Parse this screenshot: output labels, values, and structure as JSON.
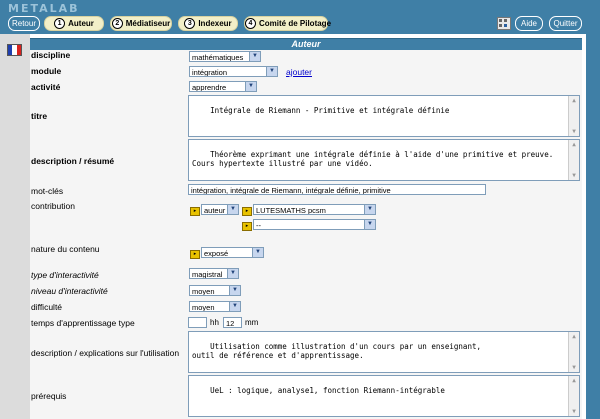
{
  "app": {
    "logo": "METALAB"
  },
  "nav": {
    "retour": "Retour",
    "steps": [
      {
        "num": "1",
        "label": "Auteur"
      },
      {
        "num": "2",
        "label": "Médiatiseur"
      },
      {
        "num": "3",
        "label": "Indexeur"
      },
      {
        "num": "4",
        "label": "Comité de Pilotage"
      }
    ],
    "aide": "Aide",
    "quitter": "Quitter"
  },
  "section_title": "Auteur",
  "colors": {
    "bar": "#3f7fa6",
    "step_bg": "#f2efc8",
    "link": "#0000cc"
  },
  "icons": {
    "flag": "french-flag-icon",
    "tool": "toolbar-grid-icon",
    "info": "info-marker-icon"
  },
  "form": {
    "discipline": {
      "label": "discipline",
      "value": "mathématiques"
    },
    "module": {
      "label": "module",
      "value": "intégration",
      "add_link": "ajouter"
    },
    "activite": {
      "label": "activité",
      "value": "apprendre"
    },
    "titre": {
      "label": "titre",
      "value": "Intégrale de Riemann - Primitive et intégrale définie"
    },
    "description": {
      "label": "description / résumé",
      "value": "Théorème exprimant une intégrale définie à l'aide d'une primitive et preuve.\nCours hypertexte illustré par une vidéo."
    },
    "motcles": {
      "label": "mot-clés",
      "value": "intégration, intégrale de Riemann, intégrale définie, primitive"
    },
    "contribution": {
      "label": "contribution",
      "role": "auteur",
      "org": "LUTESMATHS pcsm",
      "org2": "--"
    },
    "nature": {
      "label": "nature du contenu",
      "value": "exposé"
    },
    "type_interactivite": {
      "label": "type d'interactivité",
      "value": "magistral"
    },
    "niveau_interactivite": {
      "label": "niveau d'interactivité",
      "value": "moyen"
    },
    "difficulte": {
      "label": "difficulté",
      "value": "moyen"
    },
    "temps": {
      "label": "temps d'apprentissage type",
      "hh_value": "",
      "hh_unit": "hh",
      "mm_value": "12",
      "mm_unit": "mm"
    },
    "explications": {
      "label": "description / explications sur l'utilisation",
      "value": "Utilisation comme illustration d'un cours par un enseignant,\noutil de référence et d'apprentissage."
    },
    "prerequis": {
      "label": "prérequis",
      "value": "UeL : logique, analyse1, fonction Riemann-intégrable"
    }
  }
}
